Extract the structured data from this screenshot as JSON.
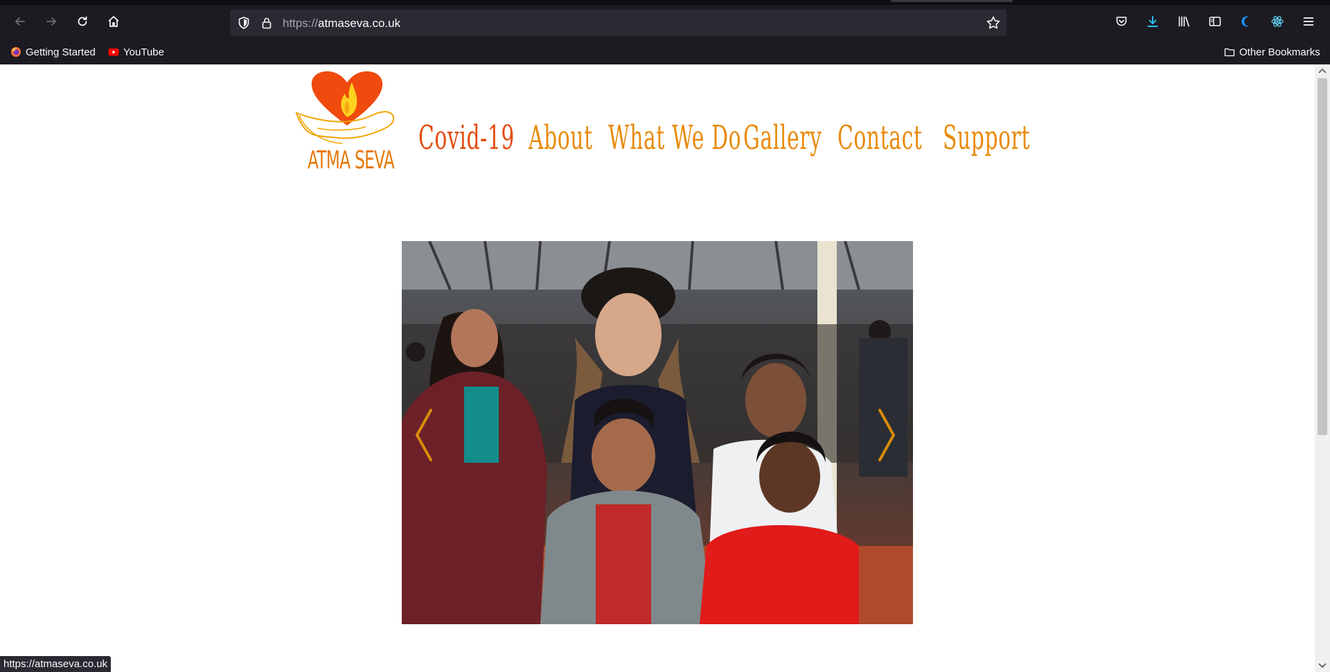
{
  "browser": {
    "url_scheme": "https://",
    "url_host": "atmaseva.co.uk",
    "bookmarks": [
      {
        "label": "Getting Started",
        "icon": "firefox-icon"
      },
      {
        "label": "YouTube",
        "icon": "youtube-icon"
      }
    ],
    "other_bookmarks_label": "Other Bookmarks",
    "status_text": "https://atmaseva.co.uk"
  },
  "site": {
    "logo_text": "ATMA SEVA",
    "nav": [
      {
        "label": "Covid-19",
        "active": true
      },
      {
        "label": "About"
      },
      {
        "label": "What We Do"
      },
      {
        "label": "Gallery"
      },
      {
        "label": "Contact"
      },
      {
        "label": "Support"
      }
    ],
    "colors": {
      "nav_text": "#e88a0a",
      "nav_active": "#e34d10",
      "logo_heart": "#f04a0e"
    }
  }
}
